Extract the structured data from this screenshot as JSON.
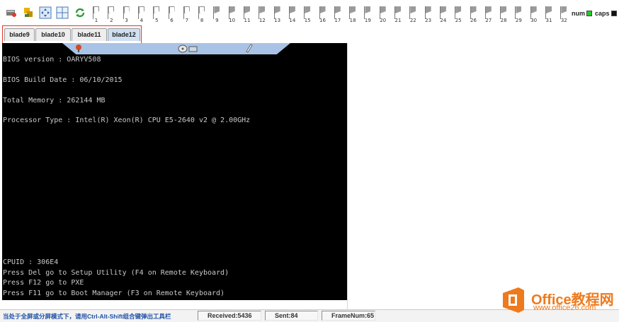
{
  "toolbar": {
    "buttons": [
      "exit-icon",
      "users-icon",
      "move-icon",
      "grid-icon",
      "refresh-icon"
    ],
    "flags": [
      {
        "num": "1",
        "style": "light"
      },
      {
        "num": "2",
        "style": "light"
      },
      {
        "num": "3",
        "style": "light"
      },
      {
        "num": "4",
        "style": "light"
      },
      {
        "num": "5",
        "style": "light"
      },
      {
        "num": "6",
        "style": "light"
      },
      {
        "num": "7",
        "style": "light"
      },
      {
        "num": "8",
        "style": "light"
      },
      {
        "num": "9",
        "style": "dark"
      },
      {
        "num": "10",
        "style": "dark"
      },
      {
        "num": "11",
        "style": "dark"
      },
      {
        "num": "12",
        "style": "dark"
      },
      {
        "num": "13",
        "style": "dark"
      },
      {
        "num": "14",
        "style": "dark"
      },
      {
        "num": "15",
        "style": "dark"
      },
      {
        "num": "16",
        "style": "dark"
      },
      {
        "num": "17",
        "style": "dark"
      },
      {
        "num": "18",
        "style": "dark"
      },
      {
        "num": "19",
        "style": "dark"
      },
      {
        "num": "20",
        "style": "dark"
      },
      {
        "num": "21",
        "style": "dark"
      },
      {
        "num": "22",
        "style": "dark"
      },
      {
        "num": "23",
        "style": "dark"
      },
      {
        "num": "24",
        "style": "dark"
      },
      {
        "num": "25",
        "style": "dark"
      },
      {
        "num": "26",
        "style": "dark"
      },
      {
        "num": "27",
        "style": "dark"
      },
      {
        "num": "28",
        "style": "dark"
      },
      {
        "num": "29",
        "style": "dark"
      },
      {
        "num": "30",
        "style": "dark"
      },
      {
        "num": "31",
        "style": "dark"
      },
      {
        "num": "32",
        "style": "dark"
      }
    ],
    "num_label": "num",
    "caps_label": "caps",
    "num_color": "#22cc22",
    "caps_color": "#111111"
  },
  "tabs": [
    {
      "label": "blade9",
      "active": false
    },
    {
      "label": "blade10",
      "active": false
    },
    {
      "label": "blade11",
      "active": false
    },
    {
      "label": "blade12",
      "active": true
    }
  ],
  "console": {
    "top_lines": [
      "BIOS version : OARYV508",
      "",
      "BIOS Build Date : 06/10/2015",
      "",
      "Total Memory : 262144 MB",
      "",
      "Processor Type : Intel(R) Xeon(R) CPU E5-2640 v2 @ 2.00GHz"
    ],
    "bottom_lines": [
      "CPUID : 306E4",
      "Press Del go to Setup Utility (F4 on Remote Keyboard)",
      "Press F12 go to PXE",
      "Press F11 go to Boot Manager (F3 on Remote Keyboard)"
    ]
  },
  "kvm_bar_icons": [
    "pin-icon",
    "disk-icon",
    "pencil-icon"
  ],
  "status": {
    "message": "当处于全屏或分屏模式下，请用Ctrl-Alt-Shift组合键弹出工具栏",
    "received": "Received:5436",
    "sent": "Sent:84",
    "frames": "FrameNum:65"
  },
  "watermark": {
    "brand": "Office教程网",
    "url": "www.office26.com",
    "color": "#ee7a1d"
  }
}
